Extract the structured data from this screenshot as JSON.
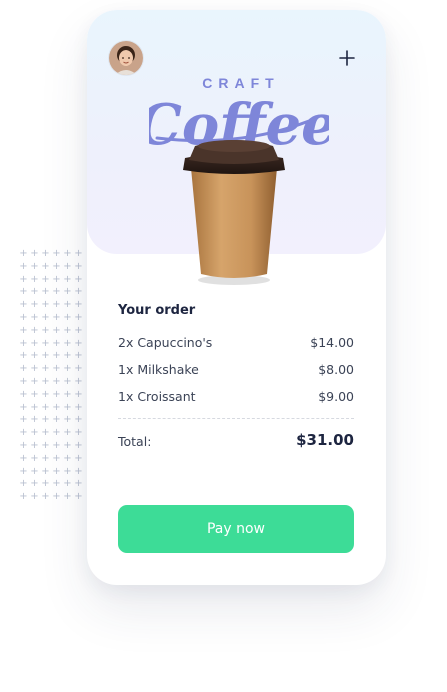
{
  "header": {
    "avatar_icon": "user-avatar",
    "add_icon": "plus-icon"
  },
  "logo": {
    "top_text": "CRAFT",
    "script_text": "Coffee",
    "color": "#7e86d9"
  },
  "order": {
    "title": "Your order",
    "items": [
      {
        "name": "2x Capuccino's",
        "price": "$14.00"
      },
      {
        "name": "1x Milkshake",
        "price": "$8.00"
      },
      {
        "name": "1x Croissant",
        "price": "$9.00"
      }
    ],
    "total_label": "Total:",
    "total_value": "$31.00"
  },
  "actions": {
    "pay_label": "Pay now",
    "pay_color": "#3ddc97"
  },
  "decor": {
    "dot_glyph": "+"
  }
}
